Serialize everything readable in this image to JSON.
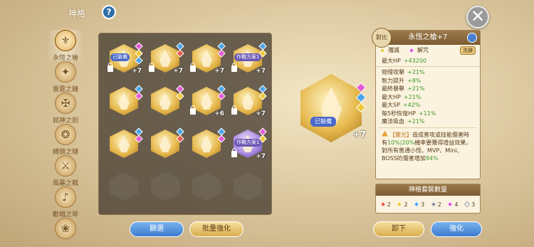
{
  "header": {
    "title": "神格",
    "help": "?",
    "close": "✕"
  },
  "nav": [
    {
      "label": "永恆之槍",
      "icon": "spear-icon",
      "glyph": "⚜",
      "active": true
    },
    {
      "label": "雷霆之錘",
      "icon": "hammer-icon",
      "glyph": "✦"
    },
    {
      "label": "弒神之劍",
      "icon": "sword-icon",
      "glyph": "✠"
    },
    {
      "label": "縛狼之鏈",
      "icon": "chain-icon",
      "glyph": "❂"
    },
    {
      "label": "風暴之戟",
      "icon": "halberd-icon",
      "glyph": "⚔"
    },
    {
      "label": "歡唱之琴",
      "icon": "lyre-icon",
      "glyph": "♪"
    },
    {
      "label": "",
      "icon": "emblem-icon",
      "glyph": "❀"
    }
  ],
  "grid": {
    "slots": [
      {
        "type": "gold",
        "tag": "已裝備",
        "level": "+7",
        "lock": true,
        "gems": [
          "pink",
          "yel",
          "blue"
        ]
      },
      {
        "type": "gold",
        "level": "+7",
        "lock": true,
        "gems": [
          "blue",
          "red"
        ]
      },
      {
        "type": "gold",
        "level": "+7",
        "lock": true,
        "gems": [
          "blue",
          "pink"
        ]
      },
      {
        "type": "gold",
        "tag": "作戰方案1",
        "level": "+7",
        "lock": true,
        "gems": [
          "blue",
          "yel"
        ]
      },
      {
        "type": "gold",
        "level": "",
        "lock": false,
        "gems": [
          "blue",
          "pink"
        ]
      },
      {
        "type": "gold",
        "level": "",
        "lock": false,
        "gems": [
          "pink",
          "yel"
        ]
      },
      {
        "type": "gold",
        "level": "+6",
        "lock": true,
        "gems": [
          "blue",
          "pink"
        ]
      },
      {
        "type": "gold",
        "level": "+7",
        "lock": true,
        "gems": [
          "blue",
          "yel"
        ]
      },
      {
        "type": "gold",
        "level": "",
        "lock": false,
        "gems": [
          "blue",
          "pink"
        ]
      },
      {
        "type": "gold",
        "level": "",
        "lock": false,
        "gems": [
          "blue",
          "red"
        ]
      },
      {
        "type": "gold",
        "level": "",
        "lock": false,
        "gems": [
          "blue",
          "pink"
        ]
      },
      {
        "type": "purple",
        "tag": "作戰方案1",
        "level": "+7",
        "lock": true,
        "gems": [
          "pink",
          "yel"
        ]
      },
      {
        "type": "empty"
      },
      {
        "type": "empty"
      },
      {
        "type": "empty"
      },
      {
        "type": "empty"
      }
    ]
  },
  "preview": {
    "tag": "已裝備",
    "level": "+7",
    "gems": [
      "pink",
      "blue",
      "yel"
    ]
  },
  "detail": {
    "compare": "對比",
    "title": "永恆之槍+7",
    "row1_left": "殲滅",
    "row1_right": "解咒",
    "row1_chip": "洗鍊",
    "hp_label": "最大HP",
    "hp_value": "+43200",
    "stats": [
      {
        "label": "物理攻擊",
        "value": "+21%"
      },
      {
        "label": "智力提升",
        "value": "+8%"
      },
      {
        "label": "最終暴擊",
        "value": "+21%"
      },
      {
        "label": "最大HP",
        "value": "+21%"
      },
      {
        "label": "最大SP",
        "value": "+42%"
      },
      {
        "label": "每5秒恢復HP",
        "value": "+11%"
      },
      {
        "label": "魔法吸血",
        "value": "+21%"
      }
    ],
    "skill_tag": "【靈光】",
    "skill_text1": "造成普攻或技能傷害時有",
    "skill_hl": "10%|20%",
    "skill_text2": "機率要獲得增益效果，對所有普通小怪、MVP、Mini、BOSS的傷害增加",
    "skill_tail": "84%"
  },
  "set": {
    "title": "神格套裝數量",
    "items": [
      {
        "gem": "red",
        "n": "2"
      },
      {
        "gem": "yel",
        "n": "2"
      },
      {
        "gem": "blue",
        "n": "3"
      },
      {
        "gem": "grey",
        "n": "2"
      },
      {
        "gem": "pink",
        "n": "4"
      },
      {
        "gem": "white",
        "n": "3"
      }
    ]
  },
  "buttons": {
    "filter": "篩選",
    "batch": "批量強化",
    "unequip": "卸下",
    "enhance": "強化"
  }
}
